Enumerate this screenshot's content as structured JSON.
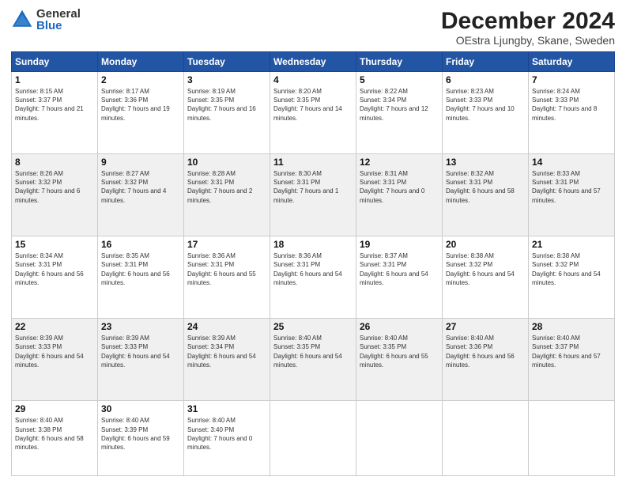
{
  "logo": {
    "general": "General",
    "blue": "Blue"
  },
  "header": {
    "title": "December 2024",
    "subtitle": "OEstra Ljungby, Skane, Sweden"
  },
  "weekdays": [
    "Sunday",
    "Monday",
    "Tuesday",
    "Wednesday",
    "Thursday",
    "Friday",
    "Saturday"
  ],
  "weeks": [
    [
      {
        "day": "1",
        "sunrise": "Sunrise: 8:15 AM",
        "sunset": "Sunset: 3:37 PM",
        "daylight": "Daylight: 7 hours and 21 minutes."
      },
      {
        "day": "2",
        "sunrise": "Sunrise: 8:17 AM",
        "sunset": "Sunset: 3:36 PM",
        "daylight": "Daylight: 7 hours and 19 minutes."
      },
      {
        "day": "3",
        "sunrise": "Sunrise: 8:19 AM",
        "sunset": "Sunset: 3:35 PM",
        "daylight": "Daylight: 7 hours and 16 minutes."
      },
      {
        "day": "4",
        "sunrise": "Sunrise: 8:20 AM",
        "sunset": "Sunset: 3:35 PM",
        "daylight": "Daylight: 7 hours and 14 minutes."
      },
      {
        "day": "5",
        "sunrise": "Sunrise: 8:22 AM",
        "sunset": "Sunset: 3:34 PM",
        "daylight": "Daylight: 7 hours and 12 minutes."
      },
      {
        "day": "6",
        "sunrise": "Sunrise: 8:23 AM",
        "sunset": "Sunset: 3:33 PM",
        "daylight": "Daylight: 7 hours and 10 minutes."
      },
      {
        "day": "7",
        "sunrise": "Sunrise: 8:24 AM",
        "sunset": "Sunset: 3:33 PM",
        "daylight": "Daylight: 7 hours and 8 minutes."
      }
    ],
    [
      {
        "day": "8",
        "sunrise": "Sunrise: 8:26 AM",
        "sunset": "Sunset: 3:32 PM",
        "daylight": "Daylight: 7 hours and 6 minutes."
      },
      {
        "day": "9",
        "sunrise": "Sunrise: 8:27 AM",
        "sunset": "Sunset: 3:32 PM",
        "daylight": "Daylight: 7 hours and 4 minutes."
      },
      {
        "day": "10",
        "sunrise": "Sunrise: 8:28 AM",
        "sunset": "Sunset: 3:31 PM",
        "daylight": "Daylight: 7 hours and 2 minutes."
      },
      {
        "day": "11",
        "sunrise": "Sunrise: 8:30 AM",
        "sunset": "Sunset: 3:31 PM",
        "daylight": "Daylight: 7 hours and 1 minute."
      },
      {
        "day": "12",
        "sunrise": "Sunrise: 8:31 AM",
        "sunset": "Sunset: 3:31 PM",
        "daylight": "Daylight: 7 hours and 0 minutes."
      },
      {
        "day": "13",
        "sunrise": "Sunrise: 8:32 AM",
        "sunset": "Sunset: 3:31 PM",
        "daylight": "Daylight: 6 hours and 58 minutes."
      },
      {
        "day": "14",
        "sunrise": "Sunrise: 8:33 AM",
        "sunset": "Sunset: 3:31 PM",
        "daylight": "Daylight: 6 hours and 57 minutes."
      }
    ],
    [
      {
        "day": "15",
        "sunrise": "Sunrise: 8:34 AM",
        "sunset": "Sunset: 3:31 PM",
        "daylight": "Daylight: 6 hours and 56 minutes."
      },
      {
        "day": "16",
        "sunrise": "Sunrise: 8:35 AM",
        "sunset": "Sunset: 3:31 PM",
        "daylight": "Daylight: 6 hours and 56 minutes."
      },
      {
        "day": "17",
        "sunrise": "Sunrise: 8:36 AM",
        "sunset": "Sunset: 3:31 PM",
        "daylight": "Daylight: 6 hours and 55 minutes."
      },
      {
        "day": "18",
        "sunrise": "Sunrise: 8:36 AM",
        "sunset": "Sunset: 3:31 PM",
        "daylight": "Daylight: 6 hours and 54 minutes."
      },
      {
        "day": "19",
        "sunrise": "Sunrise: 8:37 AM",
        "sunset": "Sunset: 3:31 PM",
        "daylight": "Daylight: 6 hours and 54 minutes."
      },
      {
        "day": "20",
        "sunrise": "Sunrise: 8:38 AM",
        "sunset": "Sunset: 3:32 PM",
        "daylight": "Daylight: 6 hours and 54 minutes."
      },
      {
        "day": "21",
        "sunrise": "Sunrise: 8:38 AM",
        "sunset": "Sunset: 3:32 PM",
        "daylight": "Daylight: 6 hours and 54 minutes."
      }
    ],
    [
      {
        "day": "22",
        "sunrise": "Sunrise: 8:39 AM",
        "sunset": "Sunset: 3:33 PM",
        "daylight": "Daylight: 6 hours and 54 minutes."
      },
      {
        "day": "23",
        "sunrise": "Sunrise: 8:39 AM",
        "sunset": "Sunset: 3:33 PM",
        "daylight": "Daylight: 6 hours and 54 minutes."
      },
      {
        "day": "24",
        "sunrise": "Sunrise: 8:39 AM",
        "sunset": "Sunset: 3:34 PM",
        "daylight": "Daylight: 6 hours and 54 minutes."
      },
      {
        "day": "25",
        "sunrise": "Sunrise: 8:40 AM",
        "sunset": "Sunset: 3:35 PM",
        "daylight": "Daylight: 6 hours and 54 minutes."
      },
      {
        "day": "26",
        "sunrise": "Sunrise: 8:40 AM",
        "sunset": "Sunset: 3:35 PM",
        "daylight": "Daylight: 6 hours and 55 minutes."
      },
      {
        "day": "27",
        "sunrise": "Sunrise: 8:40 AM",
        "sunset": "Sunset: 3:36 PM",
        "daylight": "Daylight: 6 hours and 56 minutes."
      },
      {
        "day": "28",
        "sunrise": "Sunrise: 8:40 AM",
        "sunset": "Sunset: 3:37 PM",
        "daylight": "Daylight: 6 hours and 57 minutes."
      }
    ],
    [
      {
        "day": "29",
        "sunrise": "Sunrise: 8:40 AM",
        "sunset": "Sunset: 3:38 PM",
        "daylight": "Daylight: 6 hours and 58 minutes."
      },
      {
        "day": "30",
        "sunrise": "Sunrise: 8:40 AM",
        "sunset": "Sunset: 3:39 PM",
        "daylight": "Daylight: 6 hours and 59 minutes."
      },
      {
        "day": "31",
        "sunrise": "Sunrise: 8:40 AM",
        "sunset": "Sunset: 3:40 PM",
        "daylight": "Daylight: 7 hours and 0 minutes."
      },
      null,
      null,
      null,
      null
    ]
  ]
}
